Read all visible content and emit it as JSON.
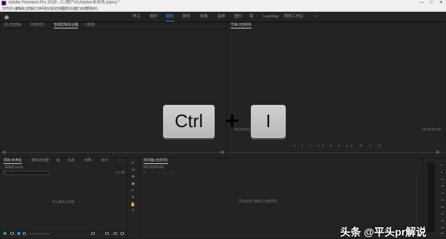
{
  "window": {
    "title": "Adobe Premiere Pro 2019 - C:\\用户\\A\\Adobe\\未命名.prproj *",
    "minimize": "—",
    "maximize": "□",
    "close": "✕"
  },
  "menu": [
    "文件(F)",
    "编辑(E)",
    "剪辑(C)",
    "序列(S)",
    "标记(M)",
    "图形(G)",
    "窗口(W)",
    "帮助(H)"
  ],
  "workspaces": [
    {
      "label": "学习",
      "active": false
    },
    {
      "label": "组件",
      "active": false
    },
    {
      "label": "编辑",
      "active": true
    },
    {
      "label": "颜色",
      "active": false
    },
    {
      "label": "效果",
      "active": false
    },
    {
      "label": "音频",
      "active": false
    },
    {
      "label": "图形",
      "active": false
    },
    {
      "label": "库",
      "active": false
    },
    {
      "label": "Learning",
      "active": false
    },
    {
      "label": "我的工作区",
      "active": false
    }
  ],
  "more_workspaces": "»",
  "source_panel": {
    "tabs": [
      {
        "label": "源:(无剪辑)",
        "active": false
      },
      {
        "label": "效果控件",
        "active": false
      },
      {
        "label": "音频剪辑混合器",
        "active": true
      },
      {
        "label": "元数据",
        "active": false
      }
    ]
  },
  "program_panel": {
    "tab": "节目:(无序列)",
    "timecode_left": "00;00;00;00",
    "timecode_right": "00;00;00;00"
  },
  "project_panel": {
    "tabs": [
      {
        "label": "项目:未命名",
        "active": true
      },
      {
        "label": "媒体浏览器",
        "active": false
      },
      {
        "label": "库",
        "active": false
      },
      {
        "label": "信息",
        "active": false
      },
      {
        "label": "效果",
        "active": false
      },
      {
        "label": "标记",
        "active": false
      }
    ],
    "project_file": "未命名.prproj",
    "item_count": "0 个项",
    "import_hint": "导入媒体以开始"
  },
  "timeline_panel": {
    "tab": "时间轴:(无序列)",
    "timecode": "00;00;00;00",
    "drop_hint": "在此处放下媒体以创建序列。"
  },
  "keys": {
    "key1": "Ctrl",
    "plus": "+",
    "key2": "I"
  },
  "meter_ticks": [
    "0",
    "-6",
    "-12",
    "-18",
    "-24",
    "-30",
    "-36",
    "-42",
    "-48",
    "-54",
    "dB"
  ],
  "watermark": "头条 @平头pr解说",
  "colors": {
    "accent": "#2d8ceb",
    "panel_bg": "#232323",
    "app_bg": "#1d1d1d"
  }
}
